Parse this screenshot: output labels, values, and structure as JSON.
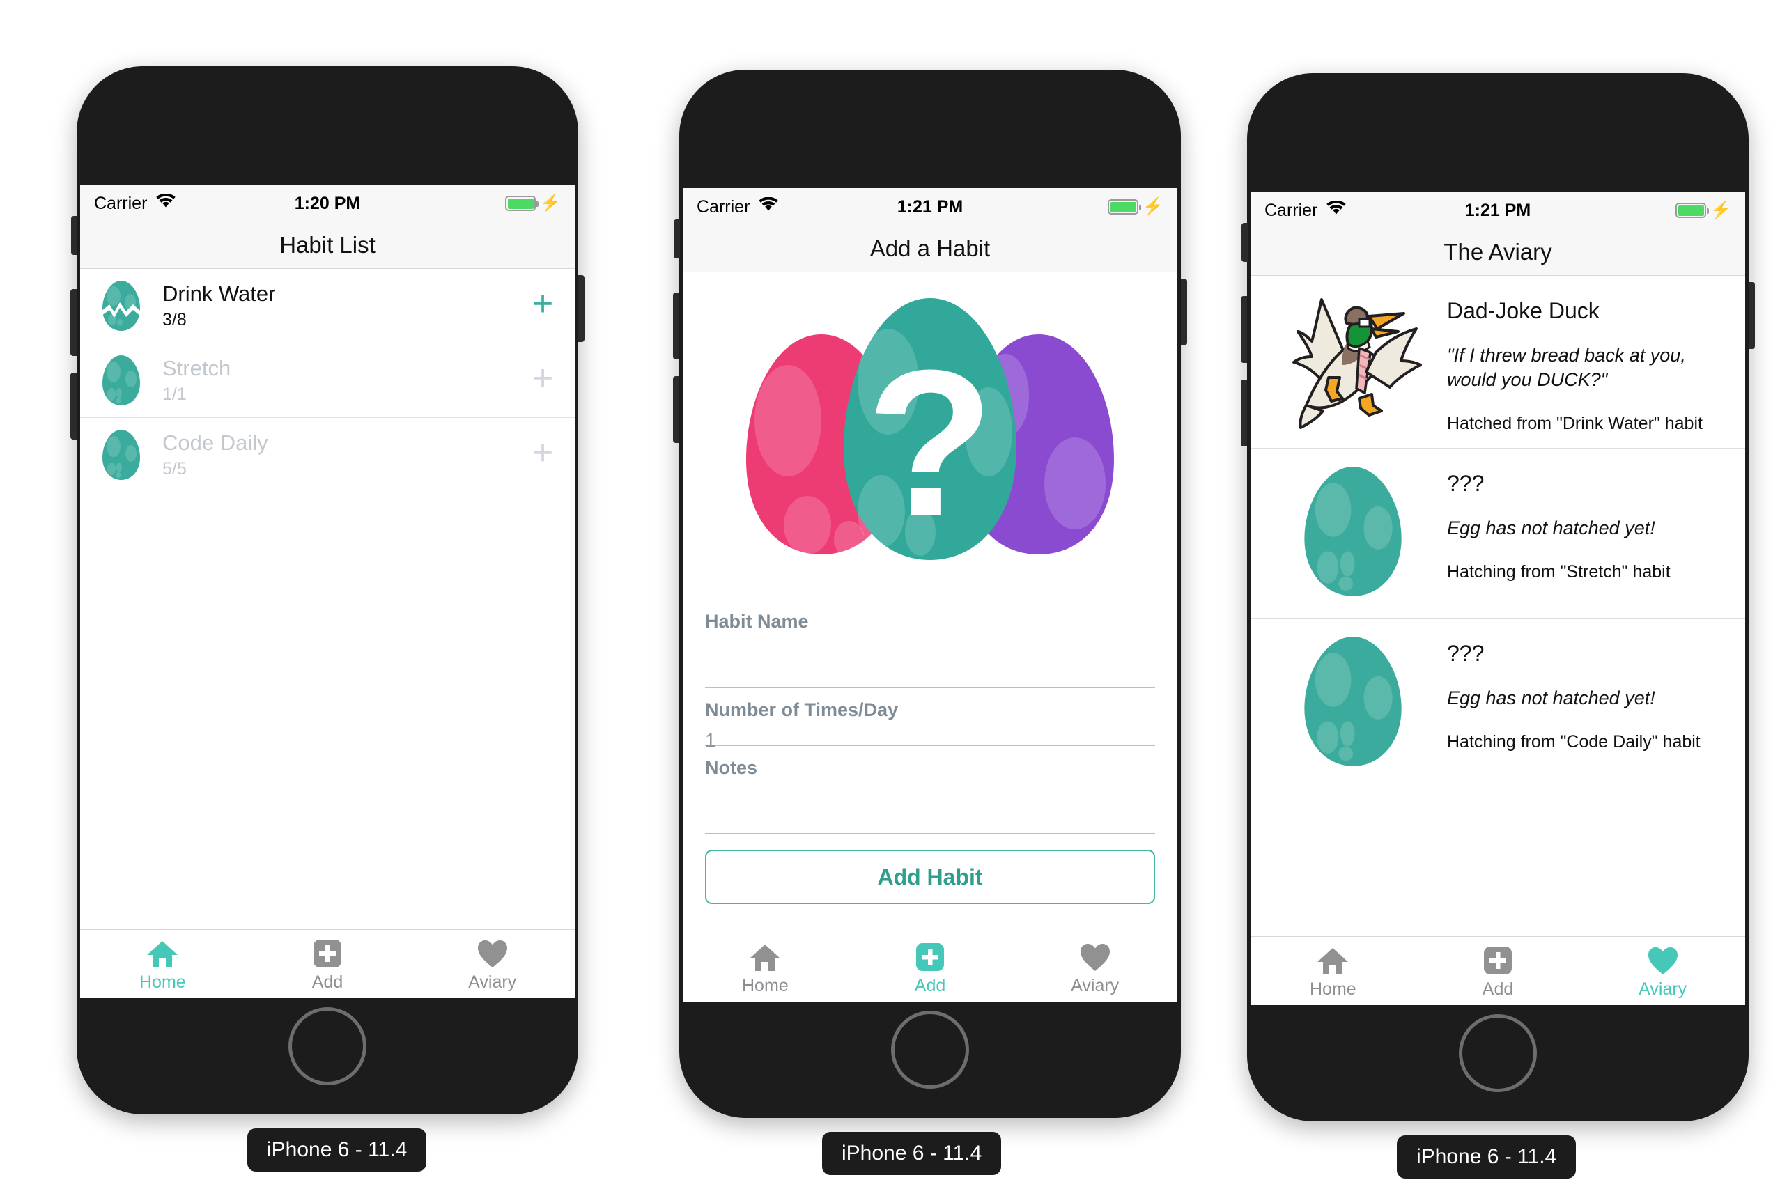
{
  "accent_color": "#45c8b8",
  "egg_color": "#3aab9c",
  "devices": [
    {
      "label": "iPhone 6 - 11.4"
    },
    {
      "label": "iPhone 6 - 11.4"
    },
    {
      "label": "iPhone 6 - 11.4"
    }
  ],
  "screen_habit_list": {
    "status": {
      "carrier": "Carrier",
      "time": "1:20 PM"
    },
    "nav_title": "Habit List",
    "habits": [
      {
        "name": "Drink Water",
        "count": "3/8",
        "state": "active",
        "egg": "cracked"
      },
      {
        "name": "Stretch",
        "count": "1/1",
        "state": "completed",
        "egg": "whole"
      },
      {
        "name": "Code Daily",
        "count": "5/5",
        "state": "completed",
        "egg": "whole"
      }
    ],
    "add_symbol": "+",
    "tabs": [
      {
        "label": "Home",
        "icon": "home-icon",
        "active": true
      },
      {
        "label": "Add",
        "icon": "plus-square-icon",
        "active": false
      },
      {
        "label": "Aviary",
        "icon": "heart-icon",
        "active": false
      }
    ]
  },
  "screen_add_habit": {
    "status": {
      "carrier": "Carrier",
      "time": "1:21 PM"
    },
    "nav_title": "Add a Habit",
    "hero_icon": "mystery-eggs-icon",
    "fields": [
      {
        "label": "Habit Name",
        "value": ""
      },
      {
        "label": "Number of Times/Day",
        "value": "1"
      },
      {
        "label": "Notes",
        "value": ""
      }
    ],
    "submit_label": "Add Habit",
    "tabs": [
      {
        "label": "Home",
        "icon": "home-icon",
        "active": false
      },
      {
        "label": "Add",
        "icon": "plus-square-icon",
        "active": true
      },
      {
        "label": "Aviary",
        "icon": "heart-icon",
        "active": false
      }
    ]
  },
  "screen_aviary": {
    "status": {
      "carrier": "Carrier",
      "time": "1:21 PM"
    },
    "nav_title": "The Aviary",
    "entries": [
      {
        "art": "duck-icon",
        "title": "Dad-Joke Duck",
        "quote": "\"If I threw bread back at you, would you DUCK?\"",
        "sub": "Hatched from \"Drink Water\" habit"
      },
      {
        "art": "egg-icon",
        "title": "???",
        "quote": "Egg has not hatched yet!",
        "sub": "Hatching from \"Stretch\" habit"
      },
      {
        "art": "egg-icon",
        "title": "???",
        "quote": "Egg has not hatched yet!",
        "sub": "Hatching from \"Code Daily\" habit"
      }
    ],
    "tabs": [
      {
        "label": "Home",
        "icon": "home-icon",
        "active": false
      },
      {
        "label": "Add",
        "icon": "plus-square-icon",
        "active": false
      },
      {
        "label": "Aviary",
        "icon": "heart-icon",
        "active": true
      }
    ]
  }
}
